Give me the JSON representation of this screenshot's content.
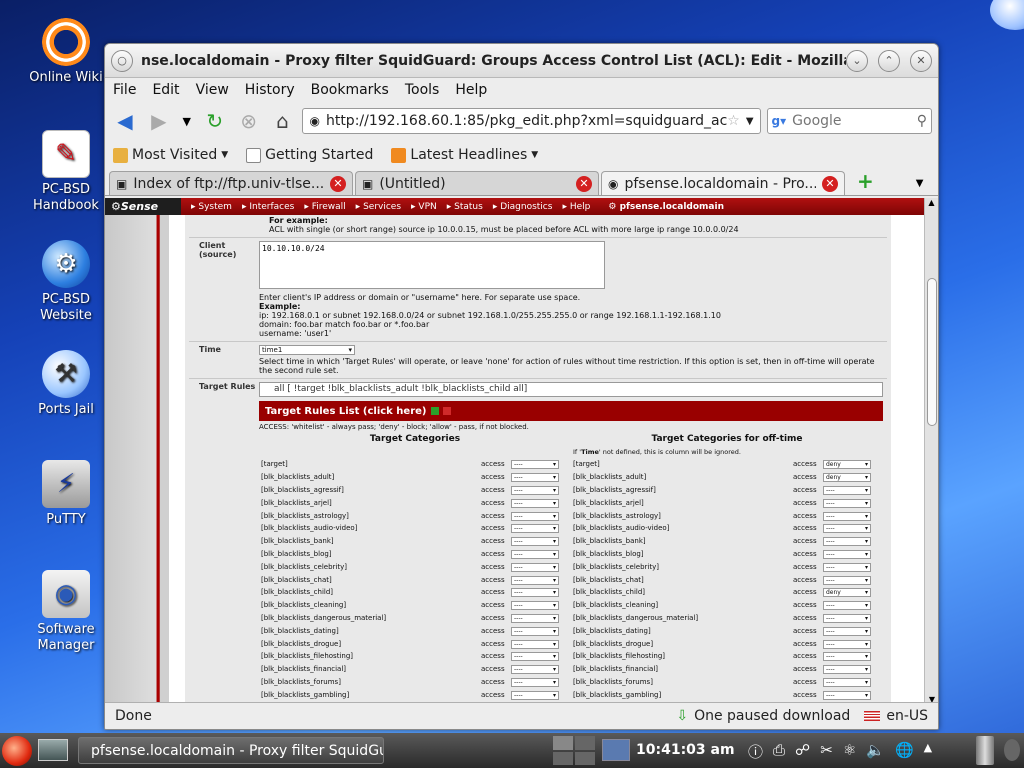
{
  "desktop": {
    "icons": [
      {
        "label": "Online Wiki"
      },
      {
        "label": "PC-BSD Handbook"
      },
      {
        "label": "PC-BSD Website"
      },
      {
        "label": "Ports Jail"
      },
      {
        "label": "PuTTY"
      },
      {
        "label": "Software Manager"
      }
    ]
  },
  "window": {
    "title": "nse.localdomain - Proxy filter SquidGuard: Groups Access Control List (ACL): Edit - Mozilla Fir"
  },
  "menu": [
    "File",
    "Edit",
    "View",
    "History",
    "Bookmarks",
    "Tools",
    "Help"
  ],
  "nav": {
    "url": "http://192.168.60.1:85/pkg_edit.php?xml=squidguard_ac",
    "search_placeholder": "Google"
  },
  "bookmarks": [
    "Most Visited",
    "Getting Started",
    "Latest Headlines"
  ],
  "tabs": [
    {
      "label": "Index of ftp://ftp.univ-tlse..."
    },
    {
      "label": "(Untitled)"
    },
    {
      "label": "pfsense.localdomain - Pro..."
    }
  ],
  "pfsense": {
    "logo": "Sense",
    "nav": [
      "System",
      "Interfaces",
      "Firewall",
      "Services",
      "VPN",
      "Status",
      "Diagnostics",
      "Help"
    ],
    "host": "pfsense.localdomain",
    "example_title": "For example:",
    "example_text": "ACL with single (or short range) source ip 10.0.0.15, must be placed before ACL with more large ip range 10.0.0.0/24",
    "client_label": "Client (source)",
    "client_value": "10.10.10.0/24",
    "client_help1": "Enter client's IP address or domain or \"username\" here. For separate use space.",
    "client_help_example": "Example:",
    "client_help2": "ip: 192.168.0.1 or subnet 192.168.0.0/24 or subnet 192.168.1.0/255.255.255.0 or range 192.168.1.1-192.168.1.10",
    "client_help3": "domain: foo.bar match foo.bar or *.foo.bar",
    "client_help4": "username: 'user1'",
    "time_label": "Time",
    "time_value": "time1",
    "time_help": "Select time in which 'Target Rules' will operate, or leave 'none' for action of rules without time restriction. If this option is set, then in off-time will operate the second rule set.",
    "rules_label": "Target Rules",
    "rules_value": "all [ !target !blk_blacklists_adult !blk_blacklists_child all]",
    "rules_header": "Target Rules List (click here)",
    "access_help": "ACCESS: 'whitelist' - always pass; 'deny' - block; 'allow' - pass, if not blocked.",
    "col_left": "Target Categories",
    "col_right": "Target Categories for off-time",
    "offtime_note_pre": "If '",
    "offtime_note_bold": "Time",
    "offtime_note_post": "' not defined, this is column will be ignored.",
    "access_word": "access",
    "categories": [
      {
        "name": "[target]",
        "left": "----",
        "right": "deny"
      },
      {
        "name": "[blk_blacklists_adult]",
        "left": "----",
        "right": "deny"
      },
      {
        "name": "[blk_blacklists_agressif]",
        "left": "----",
        "right": "----"
      },
      {
        "name": "[blk_blacklists_arjel]",
        "left": "----",
        "right": "----"
      },
      {
        "name": "[blk_blacklists_astrology]",
        "left": "----",
        "right": "----"
      },
      {
        "name": "[blk_blacklists_audio-video]",
        "left": "----",
        "right": "----"
      },
      {
        "name": "[blk_blacklists_bank]",
        "left": "----",
        "right": "----"
      },
      {
        "name": "[blk_blacklists_blog]",
        "left": "----",
        "right": "----"
      },
      {
        "name": "[blk_blacklists_celebrity]",
        "left": "----",
        "right": "----"
      },
      {
        "name": "[blk_blacklists_chat]",
        "left": "----",
        "right": "----"
      },
      {
        "name": "[blk_blacklists_child]",
        "left": "----",
        "right": "deny"
      },
      {
        "name": "[blk_blacklists_cleaning]",
        "left": "----",
        "right": "----"
      },
      {
        "name": "[blk_blacklists_dangerous_material]",
        "left": "----",
        "right": "----"
      },
      {
        "name": "[blk_blacklists_dating]",
        "left": "----",
        "right": "----"
      },
      {
        "name": "[blk_blacklists_drogue]",
        "left": "----",
        "right": "----"
      },
      {
        "name": "[blk_blacklists_filehosting]",
        "left": "----",
        "right": "----"
      },
      {
        "name": "[blk_blacklists_financial]",
        "left": "----",
        "right": "----"
      },
      {
        "name": "[blk_blacklists_forums]",
        "left": "----",
        "right": "----"
      },
      {
        "name": "[blk_blacklists_gambling]",
        "left": "----",
        "right": "----"
      }
    ]
  },
  "status": {
    "text": "Done",
    "download": "One paused download",
    "locale": "en-US"
  },
  "taskbar": {
    "task": "pfsense.localdomain - Proxy filter SquidGu",
    "clock": "10:41:03 am"
  }
}
